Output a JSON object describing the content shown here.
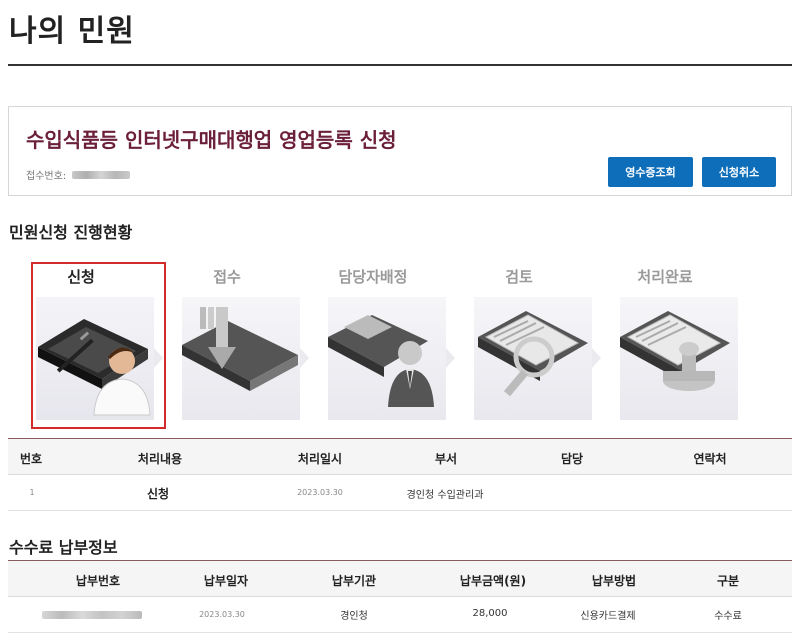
{
  "page": {
    "title": "나의 민원"
  },
  "application": {
    "title": "수입식품등 인터넷구매대행업 영업등록 신청",
    "receipt_label": "접수번호:",
    "buttons": {
      "receipt_lookup": "영수증조회",
      "cancel": "신청취소"
    }
  },
  "progress": {
    "section_title": "민원신청 진행현황",
    "active_step": "신청",
    "steps": [
      {
        "label": "신청",
        "icon": "folder-pen-person-icon"
      },
      {
        "label": "접수",
        "icon": "folder-inbox-arrow-icon"
      },
      {
        "label": "담당자배정",
        "icon": "folder-assign-person-icon"
      },
      {
        "label": "검토",
        "icon": "documents-magnifier-icon"
      },
      {
        "label": "처리완료",
        "icon": "documents-stamp-icon"
      }
    ]
  },
  "history": {
    "headers": [
      "번호",
      "처리내용",
      "처리일시",
      "부서",
      "담당",
      "연락처"
    ],
    "rows": [
      {
        "no": "1",
        "content": "신청",
        "datetime": "2023.03.30",
        "dept": "경인청 수입관리과",
        "manager": "",
        "contact": ""
      }
    ]
  },
  "fee": {
    "section_title": "수수료 납부정보",
    "headers": [
      "납부번호",
      "납부일자",
      "납부기관",
      "납부금액(원)",
      "납부방법",
      "구분"
    ],
    "rows": [
      {
        "payment_no": "",
        "date": "2023.03.30",
        "agency": "경인청",
        "amount": "28,000",
        "method": "신용카드결제",
        "category": "수수료"
      }
    ]
  },
  "colors": {
    "accent": "#0f6eb9",
    "title": "#6b1f3a",
    "highlight": "#d12b2b"
  }
}
